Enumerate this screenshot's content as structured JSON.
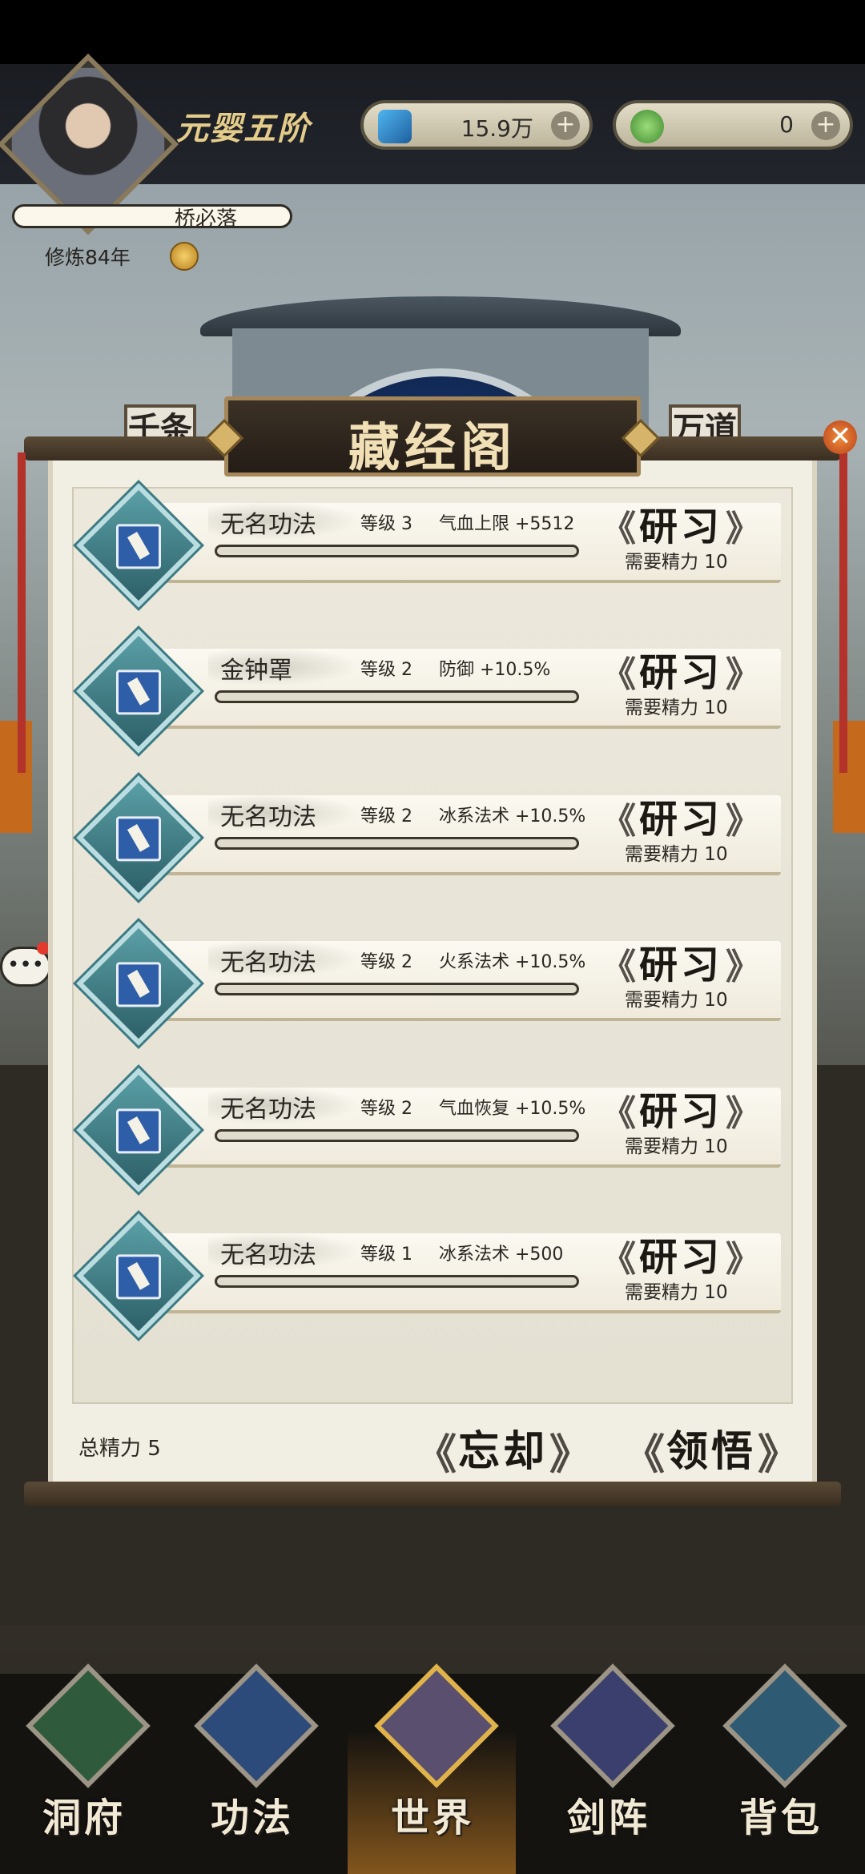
{
  "colors": {
    "accent_gold": "#e4cc8a",
    "panel_paper": "#f1eee3",
    "close_orange": "#e87a31"
  },
  "header": {
    "realm": "元婴五阶",
    "resources": [
      {
        "icon": "blue-crystal-icon",
        "value": "15.9万"
      },
      {
        "icon": "jade-coin-icon",
        "value": "0"
      }
    ],
    "player_name": "桥必落",
    "cultivation_years": "修炼84年"
  },
  "scene": {
    "couplet_left": "千条",
    "couplet_right": "万道"
  },
  "panel": {
    "title": "藏经阁",
    "close_label": "✕",
    "study_label": "研习",
    "cost_label": "需要精力 10",
    "skills": [
      {
        "name": "无名功法",
        "level": "等级 3",
        "effect": "气血上限 +5512",
        "progress": 0
      },
      {
        "name": "金钟罩",
        "level": "等级 2",
        "effect": "防御 +10.5%",
        "progress": 0
      },
      {
        "name": "无名功法",
        "level": "等级 2",
        "effect": "冰系法术 +10.5%",
        "progress": 0
      },
      {
        "name": "无名功法",
        "level": "等级 2",
        "effect": "火系法术 +10.5%",
        "progress": 0
      },
      {
        "name": "无名功法",
        "level": "等级 2",
        "effect": "气血恢复 +10.5%",
        "progress": 0
      },
      {
        "name": "无名功法",
        "level": "等级 1",
        "effect": "冰系法术 +500",
        "progress": 0
      }
    ],
    "total_energy": "总精力 5",
    "forget_label": "忘却",
    "comprehend_label": "领悟"
  },
  "chat": {
    "label": "•••"
  },
  "nav": [
    {
      "label": "洞府",
      "icon": "cave-abode-icon"
    },
    {
      "label": "功法",
      "icon": "technique-book-icon"
    },
    {
      "label": "世界",
      "icon": "world-mountain-icon",
      "active": true
    },
    {
      "label": "剑阵",
      "icon": "sword-array-icon"
    },
    {
      "label": "背包",
      "icon": "backpack-bag-icon"
    }
  ]
}
